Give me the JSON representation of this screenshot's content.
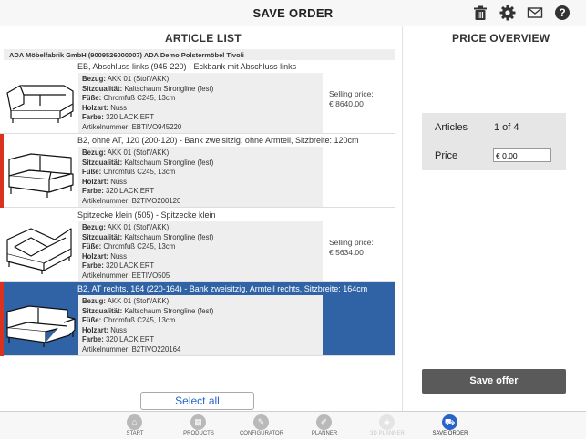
{
  "header": {
    "title": "SAVE ORDER",
    "icons": [
      "trash-icon",
      "gear-icon",
      "mail-icon",
      "help-icon"
    ]
  },
  "article_list": {
    "title": "ARTICLE LIST",
    "supplier": "ADA Möbelfabrik GmbH (9009526000007) ADA Demo Polstermöbel Tivoli",
    "items": [
      {
        "name": "EB, Abschluss links (945-220) - Eckbank mit Abschluss links",
        "flagged": false,
        "selected": false,
        "bezug": "AKK 01 (Stoff/AKK)",
        "sitzqualitaet": "Kaltschaum Strongline (fest)",
        "fuesse": "Chromfuß C245, 13cm",
        "holzart": "Nuss",
        "farbe": "320 LACKIERT",
        "artikelnummer": "EBTIVO945220",
        "price_label": "Selling price:",
        "price": "€ 8640.00"
      },
      {
        "name": "B2, ohne AT, 120 (200-120) - Bank zweisitzig, ohne Armteil, Sitzbreite: 120cm",
        "flagged": true,
        "selected": false,
        "bezug": "AKK 01 (Stoff/AKK)",
        "sitzqualitaet": "Kaltschaum Strongline (fest)",
        "fuesse": "Chromfuß C245, 13cm",
        "holzart": "Nuss",
        "farbe": "320 LACKIERT",
        "artikelnummer": "B2TIVO200120",
        "price_label": "",
        "price": ""
      },
      {
        "name": "Spitzecke klein (505) - Spitzecke klein",
        "flagged": false,
        "selected": false,
        "bezug": "AKK 01 (Stoff/AKK)",
        "sitzqualitaet": "Kaltschaum Strongline (fest)",
        "fuesse": "Chromfuß C245, 13cm",
        "holzart": "Nuss",
        "farbe": "320 LACKIERT",
        "artikelnummer": "EETIVO505",
        "price_label": "Selling price:",
        "price": "€ 5634.00"
      },
      {
        "name": "B2, AT rechts, 164 (220-164) - Bank zweisitzig, Armteil rechts, Sitzbreite: 164cm",
        "flagged": true,
        "selected": true,
        "bezug": "AKK 01 (Stoff/AKK)",
        "sitzqualitaet": "Kaltschaum Strongline (fest)",
        "fuesse": "Chromfuß C245, 13cm",
        "holzart": "Nuss",
        "farbe": "320 LACKIERT",
        "artikelnummer": "B2TIVO220164",
        "price_label": "",
        "price": ""
      }
    ],
    "field_labels": {
      "bezug": "Bezug:",
      "sitzqualitaet": "Sitzqualität:",
      "fuesse": "Füße:",
      "holzart": "Holzart:",
      "farbe": "Farbe:",
      "artikelnummer": "Artikelnummer:"
    },
    "select_all": "Select all"
  },
  "price_overview": {
    "title": "PRICE OVERVIEW",
    "articles_label": "Articles",
    "articles_value": "1 of 4",
    "price_label": "Price",
    "price_value": "€ 0.00",
    "save_offer": "Save offer"
  },
  "tabs": [
    {
      "label": "START",
      "icon": "home-icon",
      "state": "normal"
    },
    {
      "label": "PRODUCTS",
      "icon": "grid-icon",
      "state": "normal"
    },
    {
      "label": "CONFIGURATOR",
      "icon": "wrench-icon",
      "state": "normal"
    },
    {
      "label": "PLANNER",
      "icon": "pencil-icon",
      "state": "normal"
    },
    {
      "label": "3D PLANNER",
      "icon": "cube-icon",
      "state": "disabled"
    },
    {
      "label": "SAVE ORDER",
      "icon": "cart-icon",
      "state": "active"
    }
  ],
  "colors": {
    "accent": "#2a64c8",
    "selected_row": "#2f63a6",
    "flag": "#d9331f",
    "save_button": "#5a5a5a"
  }
}
